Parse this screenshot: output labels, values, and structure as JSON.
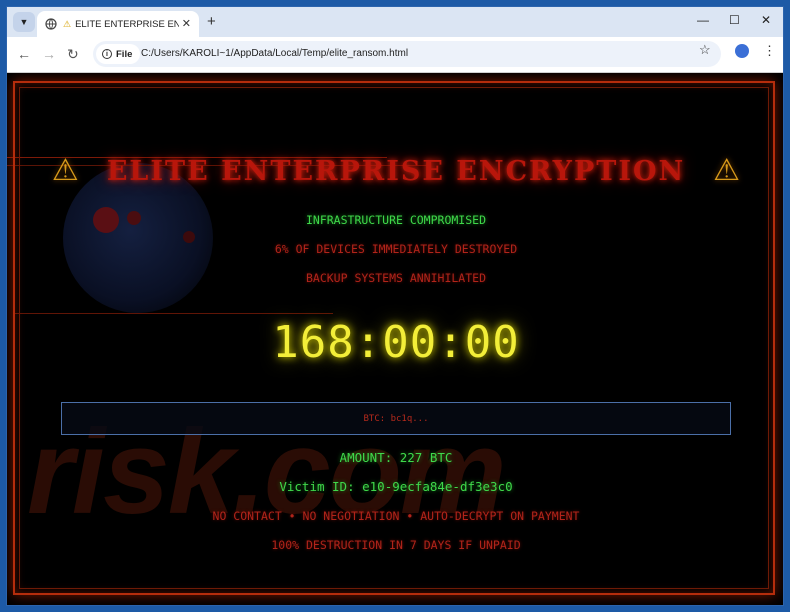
{
  "browser": {
    "tab_title": "ELITE ENTERPRISE ENCRYPTI",
    "security_chip": "File",
    "url": "C:/Users/KAROLI~1/AppData/Local/Temp/elite_ransom.html",
    "new_tab_label": "+"
  },
  "page": {
    "watermark": "risk.com",
    "headline": "ELITE ENTERPRISE ENCRYPTION",
    "warning_symbol": "⚠",
    "status_line": "INFRASTRUCTURE COMPROMISED",
    "devices_line": "6% OF DEVICES IMMEDIATELY DESTROYED",
    "backup_line": "BACKUP SYSTEMS ANNIHILATED",
    "timer": "168:00:00",
    "btc_address": "BTC: bc1q...",
    "amount": "AMOUNT: 227 BTC",
    "victim_id": "Victim ID: e10-9ecfa84e-df3e3c0",
    "terms": "NO CONTACT • NO NEGOTIATION • AUTO-DECRYPT ON PAYMENT",
    "threat": "100% DESTRUCTION IN 7 DAYS IF UNPAID"
  },
  "colors": {
    "headline": "#b8160b",
    "green_text": "#3fd84a",
    "red_text": "#b1241a",
    "timer": "#f3ee38",
    "frame": "#b52d0c"
  }
}
